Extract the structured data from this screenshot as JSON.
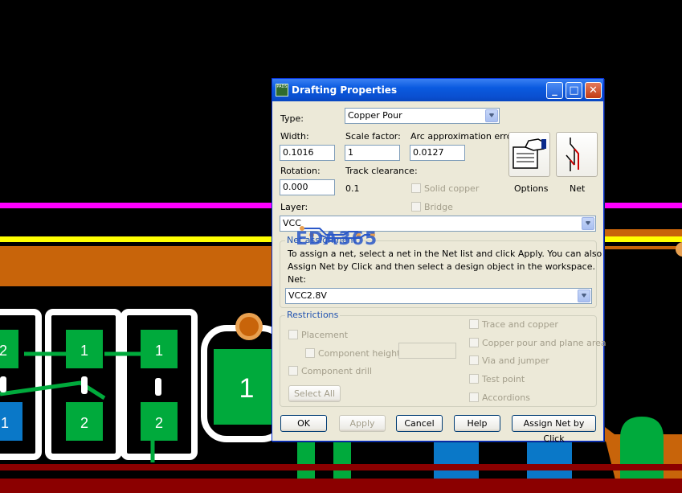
{
  "dialog": {
    "title": "Drafting Properties",
    "icon_text": "PADS",
    "min_label": "_",
    "max_label": "□",
    "close_label": "✕",
    "type_label": "Type:",
    "type_value": "Copper Pour",
    "width_label": "Width:",
    "width_value": "0.1016",
    "scale_label": "Scale factor:",
    "scale_value": "1",
    "arc_label": "Arc approximation error:",
    "arc_value": "0.0127",
    "rotation_label": "Rotation:",
    "rotation_value": "0.000",
    "track_clearance_label": "Track clearance:",
    "track_clearance_value": "0.1",
    "solid_copper_label": "Solid copper",
    "bridge_label": "Bridge",
    "layer_label": "Layer:",
    "layer_value": "VCC",
    "options_label": "Options",
    "net_button_label": "Net",
    "net_assignment": {
      "title": "Net assignment",
      "text_line1": "To assign a net, select a net in the Net list and click Apply. You can also click",
      "text_line2": "Assign Net by Click and then select a design object in the workspace.",
      "net_label": "Net:",
      "net_value": "VCC2.8V"
    },
    "restrictions": {
      "title": "Restrictions",
      "placement": "Placement",
      "component_height": "Component height",
      "component_drill": "Component drill",
      "select_all": "Select All",
      "trace_copper": "Trace and copper",
      "copper_pour_plane": "Copper pour and plane area",
      "via_jumper": "Via and jumper",
      "test_point": "Test point",
      "accordions": "Accordions"
    },
    "buttons": {
      "ok": "OK",
      "apply": "Apply",
      "cancel": "Cancel",
      "help": "Help",
      "assign_net": "Assign Net by Click"
    }
  },
  "watermark": "EDA365",
  "pads": [
    "2",
    "1",
    "1",
    "1",
    "1",
    "2",
    "2",
    "1"
  ],
  "colors": {
    "background": "#000000",
    "magenta_trace": "#ff00ff",
    "yellow_trace": "#ffff00",
    "orange_plane": "#c8640a",
    "pad_green": "#00aa3c",
    "pad_blue": "#0a78c8",
    "dark_red": "#8b0000",
    "dialog_face": "#ece9d8",
    "titlebar_blue": "#0a5ae0"
  }
}
